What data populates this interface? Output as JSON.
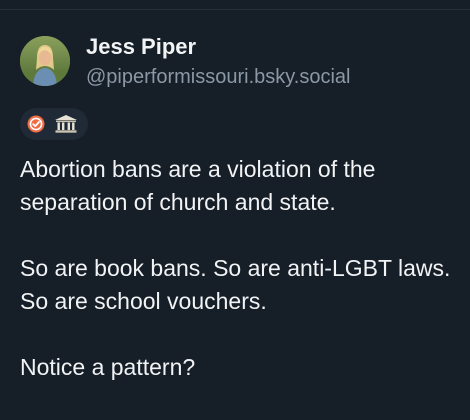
{
  "author": {
    "display_name": "Jess Piper",
    "handle": "@piperformissouri.bsky.social",
    "avatar_icon": "profile-photo",
    "badges": [
      {
        "icon": "verified-check-icon",
        "color": "#f06a43"
      },
      {
        "icon": "government-building-icon",
        "color": "#e7e2d6"
      }
    ]
  },
  "post": {
    "paragraphs": [
      "Abortion bans are a violation of the separation of church and state.",
      "So are book bans. So are anti-LGBT laws. So are school vouchers.",
      "Notice a pattern?"
    ]
  },
  "colors": {
    "background": "#161e27",
    "text": "#f1f3f5",
    "handle_text": "#8b98a5",
    "badge_pill": "#1f2a36"
  }
}
